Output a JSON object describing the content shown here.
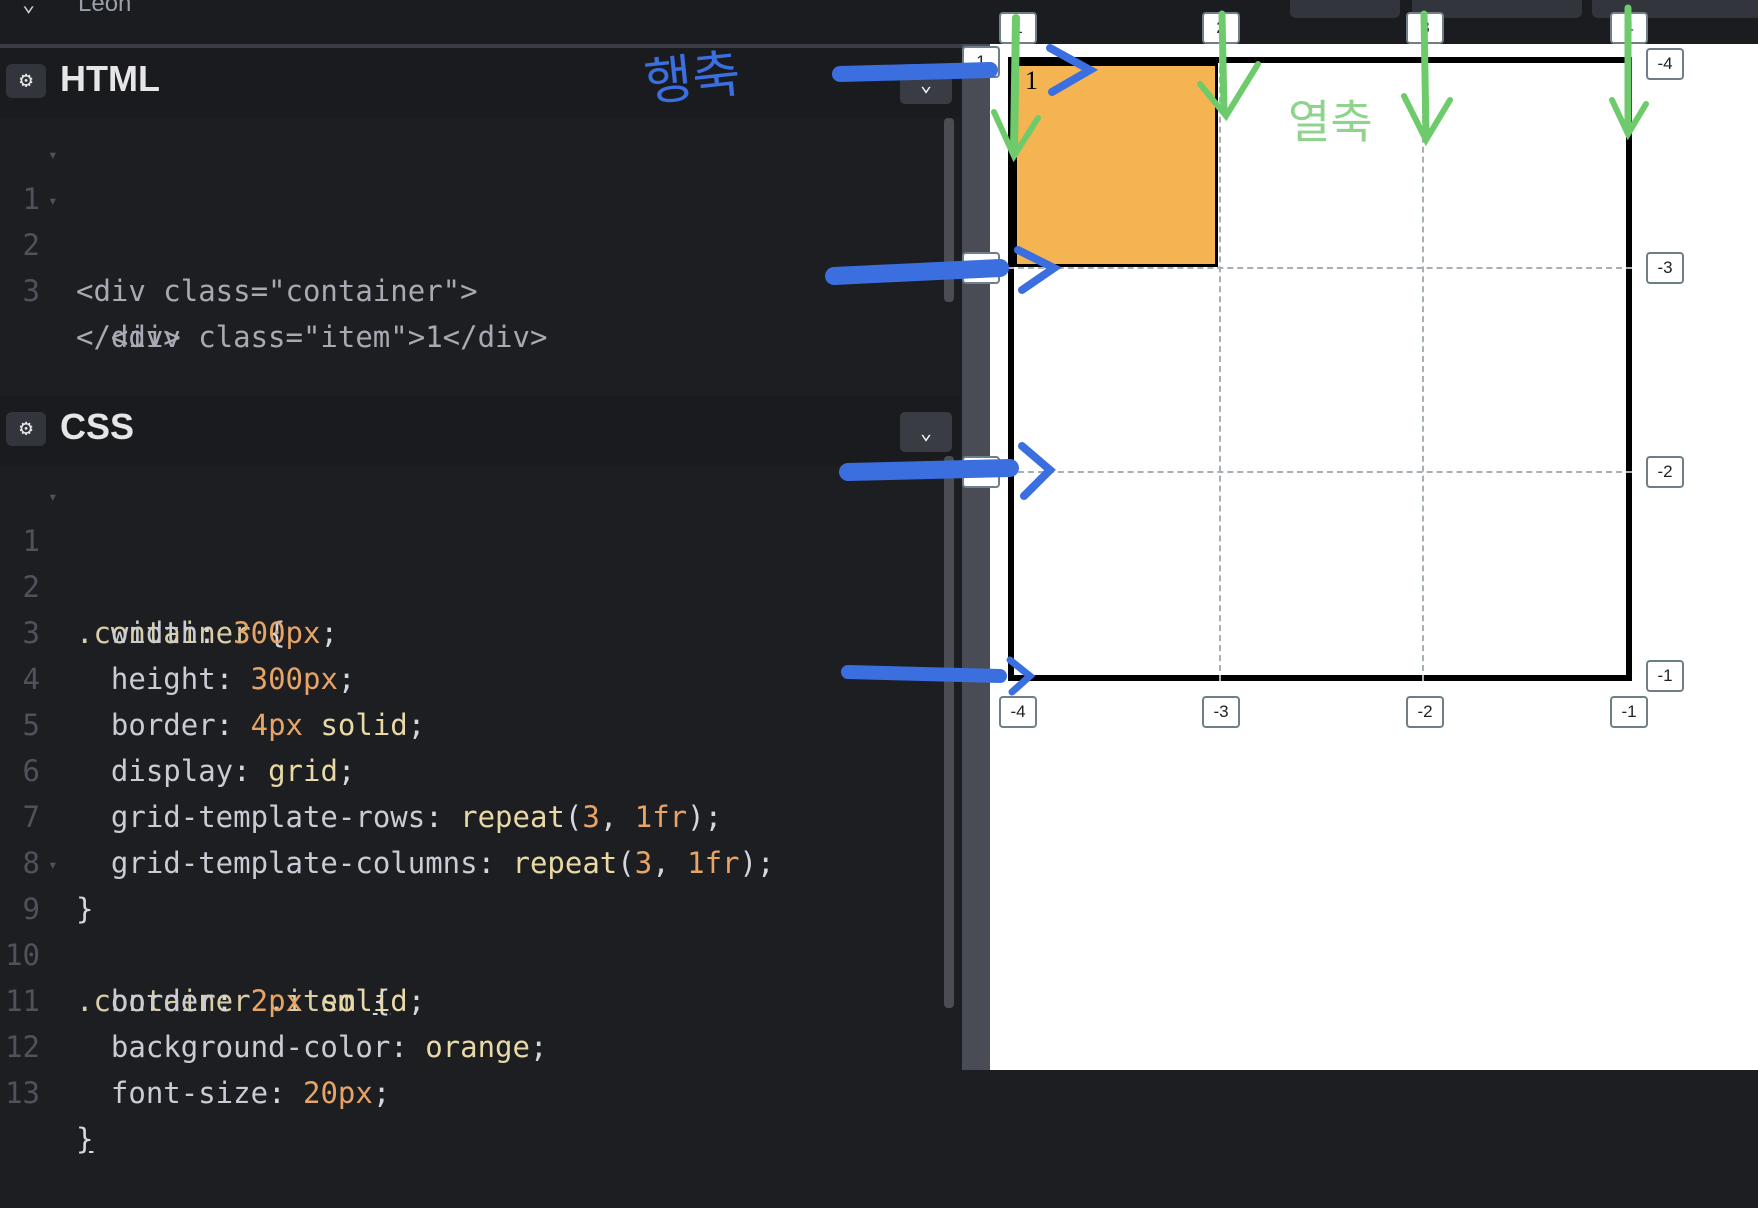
{
  "topbar": {
    "user": "Leon"
  },
  "html_panel": {
    "title": "HTML",
    "lines": [
      [
        "1",
        "<div class=\"container\">"
      ],
      [
        "2",
        "  <div class=\"item\">1</div>"
      ],
      [
        "3",
        "</div>"
      ]
    ]
  },
  "css_panel": {
    "title": "CSS",
    "line_numbers": [
      "1",
      "2",
      "3",
      "4",
      "5",
      "6",
      "7",
      "8",
      "9",
      "10",
      "11",
      "12",
      "13"
    ],
    "selector_container": ".container",
    "selector_item": ".container .item",
    "brace_open": "{",
    "brace_close": "}",
    "props": {
      "width": "width",
      "width_val": "300px",
      "height": "height",
      "height_val": "300px",
      "border": "border",
      "border_val_num": "4px",
      "border_val_kw": "solid",
      "display": "display",
      "display_val": "grid",
      "rows": "grid-template-rows",
      "repeat": "repeat",
      "three": "3",
      "fr": "1fr",
      "cols": "grid-template-columns",
      "item_border_num": "2px",
      "item_border_kw": "solid",
      "bg": "background-color",
      "bg_val": "orange",
      "fs": "font-size",
      "fs_val": "20px"
    }
  },
  "preview": {
    "item_text": "1",
    "col_lines_top": [
      "1",
      "2",
      "3",
      "4"
    ],
    "col_lines_bottom": [
      "-4",
      "-3",
      "-2",
      "-1"
    ],
    "row_lines_left": [
      "1",
      "2",
      "3"
    ],
    "row_lines_right": [
      "-4",
      "-3",
      "-2",
      "-1"
    ],
    "annotation_rows": "행축",
    "annotation_cols": "열축"
  },
  "colors": {
    "item_fill": "#f4b451",
    "blue_marker": "#3b6fe0",
    "green_marker": "#6ecb6b"
  }
}
